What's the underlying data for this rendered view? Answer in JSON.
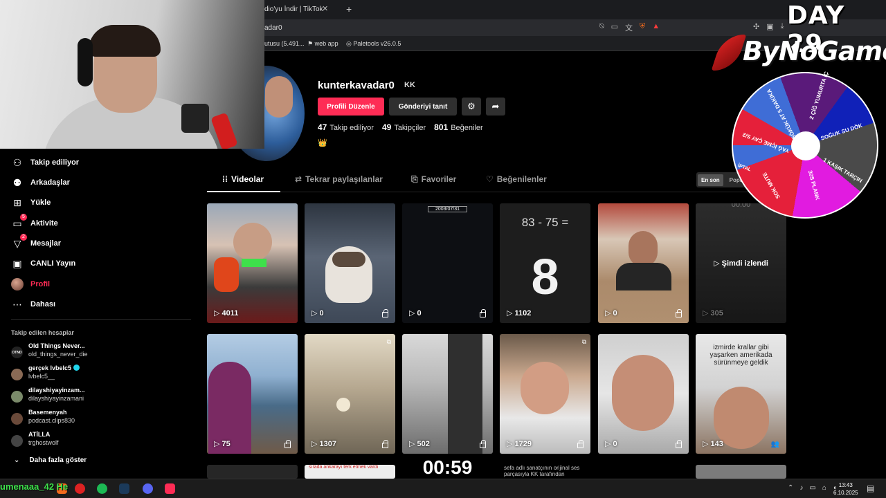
{
  "browser": {
    "tab_title": "dio'yu İndir | TikTok",
    "tab_close": "✕",
    "new_tab": "+",
    "url": "adar0",
    "bookmarks": [
      "utusu (5.491...",
      "web app",
      "Paletools v26.0.5"
    ]
  },
  "overlay": {
    "day": "DAY 29",
    "brand": "ByNoGame",
    "wheel_labels": [
      "2 ÇİĞ YUMURTA İÇ",
      "SOĞUK SU DÖK",
      "1 KAŞIK TARÇIN",
      "30S PLANK",
      "SOK MUTE",
      "YAĞ İÇME ÇAY S/2",
      "ŞÖKÜK AT 5 DAKİKA",
      "İPTAL"
    ]
  },
  "sidebar": {
    "nav": [
      {
        "label": "Takip ediliyor",
        "icon": "following-icon"
      },
      {
        "label": "Arkadaşlar",
        "icon": "friends-icon"
      },
      {
        "label": "Yükle",
        "icon": "upload-icon"
      },
      {
        "label": "Aktivite",
        "icon": "activity-icon",
        "badge": "5"
      },
      {
        "label": "Mesajlar",
        "icon": "messages-icon",
        "badge": "2"
      },
      {
        "label": "CANLI Yayın",
        "icon": "live-icon"
      },
      {
        "label": "Profil",
        "icon": "profile-avatar"
      },
      {
        "label": "Dahası",
        "icon": "more-icon"
      }
    ],
    "following_heading": "Takip edilen hesaplar",
    "accounts": [
      {
        "name": "Old Things Never...",
        "handle": "old_things_never_die",
        "avatar_text": "OTND"
      },
      {
        "name": "gerçek lvbelc5",
        "handle": "lvbelc5__",
        "verified": true
      },
      {
        "name": "dilayshiyayinzam...",
        "handle": "dilayshiyayinzamani"
      },
      {
        "name": "Basemenyah",
        "handle": "podcast.clips830"
      },
      {
        "name": "ATİLLA",
        "handle": "trghostwolf"
      }
    ],
    "show_more": "Daha fazla göster"
  },
  "profile": {
    "username": "kunterkavadar0",
    "nickname": "KK",
    "edit_button": "Profili Düzenle",
    "promote_button": "Gönderiyi tanıt",
    "following_count": "47",
    "following_label": "Takip ediliyor",
    "followers_count": "49",
    "followers_label": "Takipçiler",
    "likes_count": "801",
    "likes_label": "Beğeniler",
    "bio": "👑"
  },
  "tabs": [
    "Videolar",
    "Tekrar paylaşılanlar",
    "Favoriler",
    "Beğenilenler"
  ],
  "sort": {
    "latest": "En son",
    "popular": "Popü"
  },
  "videos_row1": [
    {
      "views": "4011",
      "locked": false,
      "corner": ""
    },
    {
      "views": "0",
      "locked": true,
      "corner": ""
    },
    {
      "views": "0",
      "locked": true,
      "overlay": "2003/07/31"
    },
    {
      "views": "1102",
      "locked": false,
      "overlay": "83 - 75 =",
      "big": "8"
    },
    {
      "views": "0",
      "locked": true
    },
    {
      "views": "305",
      "locked": false,
      "overlay": "00:00",
      "watching": "▷ Şimdi izlendi"
    }
  ],
  "videos_row2": [
    {
      "views": "75",
      "locked": true
    },
    {
      "views": "1307",
      "locked": true,
      "corner": "⧉"
    },
    {
      "views": "502",
      "locked": true
    },
    {
      "views": "1729",
      "locked": true,
      "corner": "⧉"
    },
    {
      "views": "0",
      "locked": true
    },
    {
      "views": "143",
      "locked": false,
      "overlay": "izmirde krallar gibi yaşarken amerikada sürünmeye geldik",
      "friends": true
    }
  ],
  "videos_row3": [
    {
      "overlay": "sırada ankarayı terk etmek vardı"
    },
    {
      "overlay": "00:59"
    },
    {
      "overlay": "sefa adlı sanatçının orijinal ses parçasıyla KK tarafından"
    }
  ],
  "taskbar": {
    "streamer": "umenaaa_42 He",
    "time": "13:43",
    "date": "6.10.2025"
  }
}
